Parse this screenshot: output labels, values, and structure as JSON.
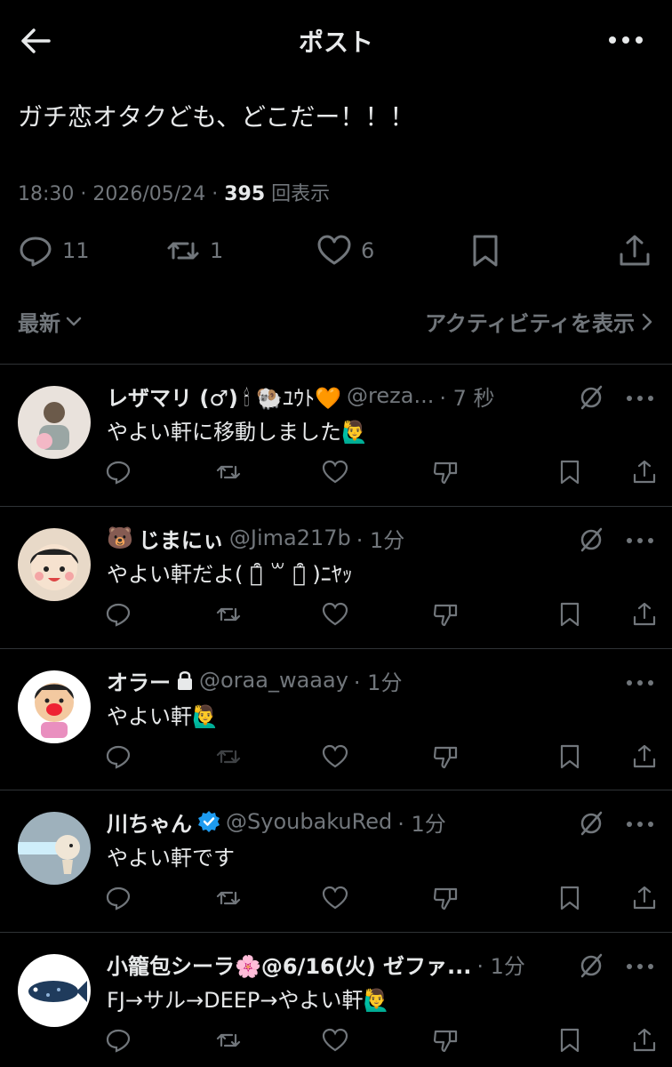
{
  "header": {
    "title": "ポスト"
  },
  "post": {
    "text": "ガチ恋オタクども、どこだー！！！",
    "time": "18:30",
    "date": "2026/05/24",
    "views_count": "395",
    "views_label": "回表示",
    "replies": "11",
    "reposts": "1",
    "likes": "6"
  },
  "sort": {
    "label": "最新",
    "activity": "アクティビティを表示"
  },
  "replies": [
    {
      "name": "レザマリ (♂)",
      "name_emoji": "🕯 🐏ﾕｳﾄ🧡",
      "handle": "@reza...",
      "time": "· 7 秒",
      "text": "やよい軒に移動しました🙋‍♂️",
      "avatar_color": "#e9e2dc"
    },
    {
      "name_prefix": "🐻",
      "name": "じまにぃ",
      "handle": "@Jima217b",
      "time": "· 1分",
      "text": "やよい軒だよ( ꒪͒ ꒳ ꒪͒ )ﾆﾔｯ",
      "avatar_color": "#e8d9c8"
    },
    {
      "name": "オラー",
      "name_emoji": "🔒",
      "handle": "@oraa_waaay",
      "time": "· 1分",
      "text": "やよい軒🙋‍♂️",
      "avatar_color": "#ffffff"
    },
    {
      "name": "川ちゃん",
      "name_emoji": "✔",
      "handle": "@SyoubakuRed",
      "time": "· 1分",
      "text": "やよい軒です",
      "avatar_color": "#9eb1bc"
    },
    {
      "name": "小籠包シーラ🌸@6/16(火) ゼファ...",
      "handle": "",
      "time": "· 1分",
      "text": "FJ→サル→DEEP→やよい軒🙋‍♂️",
      "avatar_color": "#ffffff"
    }
  ],
  "colors": {
    "background": "#000000",
    "text": "#e7e9ea",
    "muted": "#71767b",
    "verified": "#1d9bf0",
    "divider": "#2f3336"
  }
}
